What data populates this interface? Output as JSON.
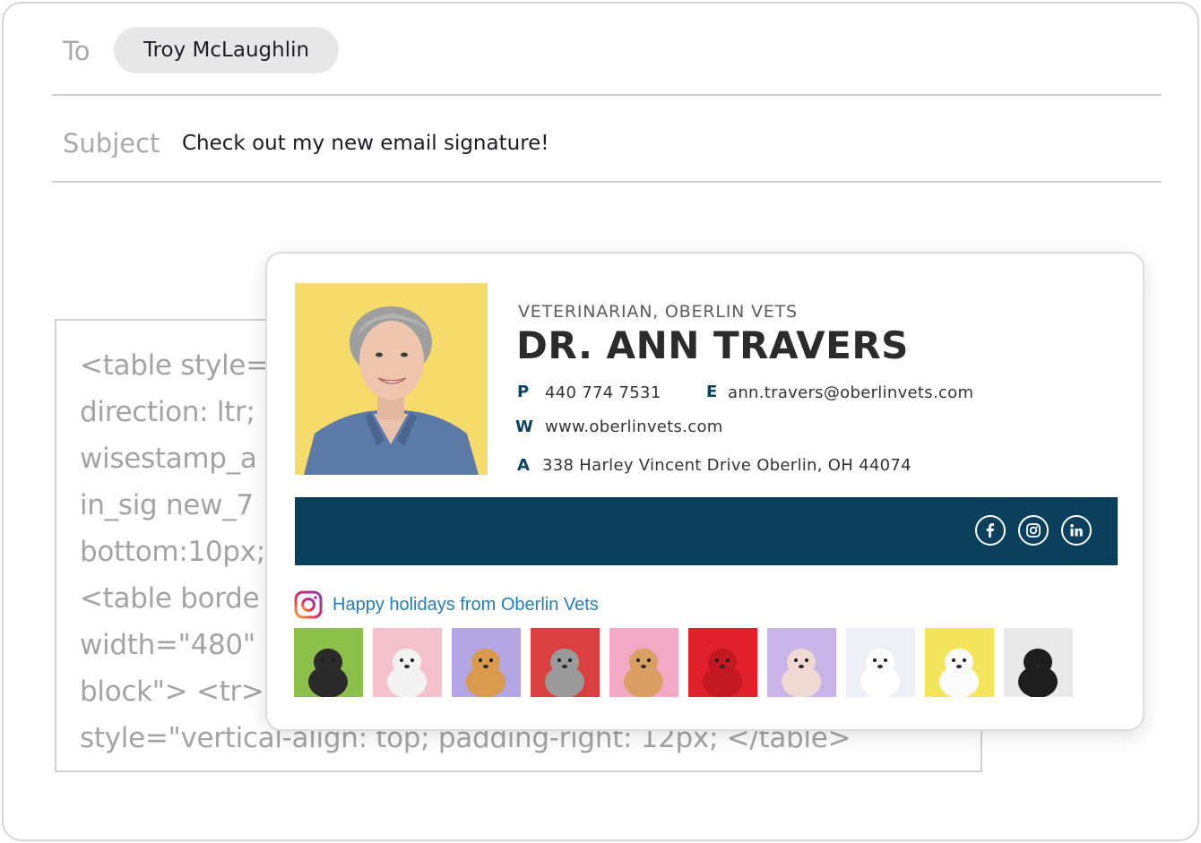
{
  "compose": {
    "to_label": "To",
    "recipient": "Troy McLaughlin",
    "subject_label": "Subject",
    "subject": "Check out my new email signature!"
  },
  "code_preview": {
    "lines": [
      "<table style=\"",
      "direction: ltr; '",
      "wisestamp_a",
      "in_sig new_7",
      "bottom:10px;",
      "<table borde",
      "width=\"480\" s",
      "block\"> <tr> <",
      "style=\"vertical-align: top; padding-right: 12px; </table>"
    ]
  },
  "signature": {
    "job_title": "VETERINARIAN, OBERLIN VETS",
    "name": "DR. ANN TRAVERS",
    "phone_key": "P",
    "phone": "440 774 7531",
    "email_key": "E",
    "email": "ann.travers@oberlinvets.com",
    "website_key": "W",
    "website": "www.oberlinvets.com",
    "address_key": "A",
    "address": "338 Harley Vincent Drive Oberlin, OH 44074",
    "social_icons": [
      "facebook-icon",
      "instagram-icon",
      "linkedin-icon"
    ],
    "banner_text": "Happy holidays from Oberlin Vets",
    "banner_icon": "instagram-icon",
    "colors": {
      "brand": "#0b405c",
      "banner_link": "#1f7fb8",
      "photo_bg": "#f5dc6a"
    }
  },
  "pets": [
    {
      "name": "puppy-party-hat",
      "bg": "#8cc04a",
      "body": "#2b2b2b"
    },
    {
      "name": "french-bulldog-puppy",
      "bg": "#f4c1cc",
      "body": "#f2f2f2"
    },
    {
      "name": "shiba-inu",
      "bg": "#b4a6e4",
      "body": "#d99a4e"
    },
    {
      "name": "cat-bread-costume",
      "bg": "#d9403f",
      "body": "#9a9a9a"
    },
    {
      "name": "shiba-party-hat",
      "bg": "#f2a9c6",
      "body": "#d9a064"
    },
    {
      "name": "dog-red-hoodie",
      "bg": "#e0202a",
      "body": "#c41822"
    },
    {
      "name": "sphynx-cat",
      "bg": "#c9b4e8",
      "body": "#f0d9d2"
    },
    {
      "name": "white-rabbit-purple",
      "bg": "#eeeef6",
      "body": "#ffffff"
    },
    {
      "name": "rabbit-yellow",
      "bg": "#f3e55a",
      "body": "#fafafa"
    },
    {
      "name": "black-pug",
      "bg": "#e9e9e9",
      "body": "#1e1e1e"
    }
  ]
}
